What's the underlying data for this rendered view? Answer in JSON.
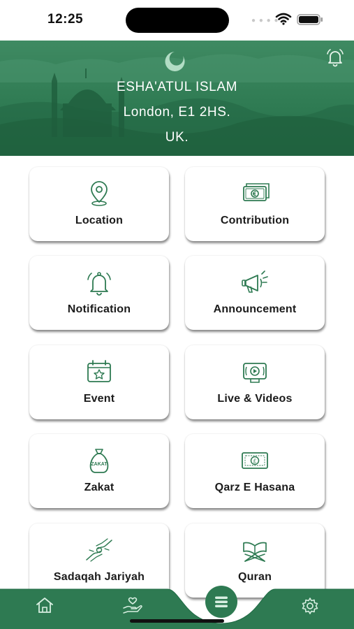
{
  "status": {
    "time": "12:25"
  },
  "header": {
    "line1": "ESHA'ATUL ISLAM",
    "line2": "London, E1 2HS.",
    "line3": "UK."
  },
  "grid": {
    "items": [
      {
        "label": "Location",
        "icon": "location-pin-icon"
      },
      {
        "label": "Contribution",
        "icon": "money-stack-icon"
      },
      {
        "label": "Notification",
        "icon": "bell-icon"
      },
      {
        "label": "Announcement",
        "icon": "megaphone-icon"
      },
      {
        "label": "Event",
        "icon": "calendar-star-icon"
      },
      {
        "label": "Live & Videos",
        "icon": "video-play-icon"
      },
      {
        "label": "Zakat",
        "icon": "zakat-bag-icon",
        "icon_text": "ZAKAT"
      },
      {
        "label": "Qarz E Hasana",
        "icon": "banknote-pound-icon",
        "icon_text": "£"
      },
      {
        "label": "Sadaqah Jariyah",
        "icon": "giving-hands-icon"
      },
      {
        "label": "Quran",
        "icon": "quran-stand-icon"
      }
    ]
  },
  "bottom_nav": {
    "items": [
      "home-icon",
      "charity-hand-icon",
      "menu-icon",
      "gear-icon"
    ]
  },
  "colors": {
    "primary": "#2e7a52",
    "dark": "#1f6a44",
    "icon_stroke": "#2e7a52"
  }
}
